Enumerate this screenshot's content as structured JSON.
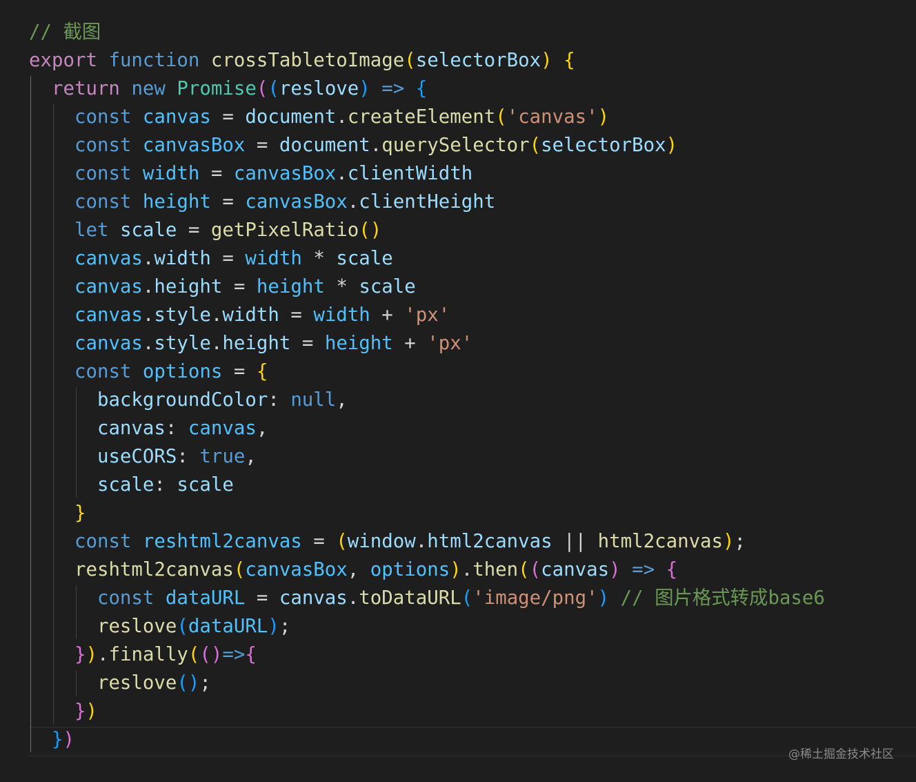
{
  "colors": {
    "background": "#1e1e1e",
    "keyword": "#c586c0",
    "storage": "#569cd6",
    "function": "#dcdcaa",
    "variable": "#9cdcfe",
    "constant": "#4fc1ff",
    "class": "#4ec9b0",
    "string": "#ce9178",
    "comment": "#6a9955",
    "text": "#d4d4d4",
    "bracket1": "#ffd700",
    "bracket2": "#da70d6",
    "bracket3": "#179fff"
  },
  "code": {
    "lines": [
      {
        "indent": 0,
        "tokens": [
          {
            "t": "// 截图",
            "c": "comment"
          }
        ]
      },
      {
        "indent": 0,
        "tokens": [
          {
            "t": "export",
            "c": "keyword"
          },
          {
            "t": " "
          },
          {
            "t": "function",
            "c": "storage"
          },
          {
            "t": " "
          },
          {
            "t": "crossTabletoImage",
            "c": "function"
          },
          {
            "t": "(",
            "c": "bracket1"
          },
          {
            "t": "selectorBox",
            "c": "variable"
          },
          {
            "t": ")",
            "c": "bracket1"
          },
          {
            "t": " "
          },
          {
            "t": "{",
            "c": "bracket1"
          }
        ]
      },
      {
        "indent": 1,
        "tokens": [
          {
            "t": "return",
            "c": "keyword"
          },
          {
            "t": " "
          },
          {
            "t": "new",
            "c": "storage"
          },
          {
            "t": " "
          },
          {
            "t": "Promise",
            "c": "class"
          },
          {
            "t": "(",
            "c": "bracket2"
          },
          {
            "t": "(",
            "c": "bracket3"
          },
          {
            "t": "reslove",
            "c": "variable"
          },
          {
            "t": ")",
            "c": "bracket3"
          },
          {
            "t": " "
          },
          {
            "t": "=>",
            "c": "storage"
          },
          {
            "t": " "
          },
          {
            "t": "{",
            "c": "bracket3"
          }
        ]
      },
      {
        "indent": 2,
        "tokens": [
          {
            "t": "const",
            "c": "storage"
          },
          {
            "t": " "
          },
          {
            "t": "canvas",
            "c": "constant"
          },
          {
            "t": " "
          },
          {
            "t": "=",
            "c": "text"
          },
          {
            "t": " "
          },
          {
            "t": "document",
            "c": "variable"
          },
          {
            "t": "."
          },
          {
            "t": "createElement",
            "c": "function"
          },
          {
            "t": "(",
            "c": "bracket1"
          },
          {
            "t": "'canvas'",
            "c": "string"
          },
          {
            "t": ")",
            "c": "bracket1"
          }
        ]
      },
      {
        "indent": 2,
        "tokens": [
          {
            "t": "const",
            "c": "storage"
          },
          {
            "t": " "
          },
          {
            "t": "canvasBox",
            "c": "constant"
          },
          {
            "t": " "
          },
          {
            "t": "=",
            "c": "text"
          },
          {
            "t": " "
          },
          {
            "t": "document",
            "c": "variable"
          },
          {
            "t": "."
          },
          {
            "t": "querySelector",
            "c": "function"
          },
          {
            "t": "(",
            "c": "bracket1"
          },
          {
            "t": "selectorBox",
            "c": "variable"
          },
          {
            "t": ")",
            "c": "bracket1"
          }
        ]
      },
      {
        "indent": 2,
        "tokens": [
          {
            "t": "const",
            "c": "storage"
          },
          {
            "t": " "
          },
          {
            "t": "width",
            "c": "constant"
          },
          {
            "t": " "
          },
          {
            "t": "=",
            "c": "text"
          },
          {
            "t": " "
          },
          {
            "t": "canvasBox",
            "c": "constant"
          },
          {
            "t": "."
          },
          {
            "t": "clientWidth",
            "c": "variable"
          }
        ]
      },
      {
        "indent": 2,
        "tokens": [
          {
            "t": "const",
            "c": "storage"
          },
          {
            "t": " "
          },
          {
            "t": "height",
            "c": "constant"
          },
          {
            "t": " "
          },
          {
            "t": "=",
            "c": "text"
          },
          {
            "t": " "
          },
          {
            "t": "canvasBox",
            "c": "constant"
          },
          {
            "t": "."
          },
          {
            "t": "clientHeight",
            "c": "variable"
          }
        ]
      },
      {
        "indent": 2,
        "tokens": [
          {
            "t": "let",
            "c": "storage"
          },
          {
            "t": " "
          },
          {
            "t": "scale",
            "c": "variable"
          },
          {
            "t": " "
          },
          {
            "t": "=",
            "c": "text"
          },
          {
            "t": " "
          },
          {
            "t": "getPixelRatio",
            "c": "function"
          },
          {
            "t": "(",
            "c": "bracket1"
          },
          {
            "t": ")",
            "c": "bracket1"
          }
        ]
      },
      {
        "indent": 2,
        "tokens": [
          {
            "t": "canvas",
            "c": "constant"
          },
          {
            "t": "."
          },
          {
            "t": "width",
            "c": "variable"
          },
          {
            "t": " "
          },
          {
            "t": "=",
            "c": "text"
          },
          {
            "t": " "
          },
          {
            "t": "width",
            "c": "constant"
          },
          {
            "t": " "
          },
          {
            "t": "*",
            "c": "text"
          },
          {
            "t": " "
          },
          {
            "t": "scale",
            "c": "variable"
          }
        ]
      },
      {
        "indent": 2,
        "tokens": [
          {
            "t": "canvas",
            "c": "constant"
          },
          {
            "t": "."
          },
          {
            "t": "height",
            "c": "variable"
          },
          {
            "t": " "
          },
          {
            "t": "=",
            "c": "text"
          },
          {
            "t": " "
          },
          {
            "t": "height",
            "c": "constant"
          },
          {
            "t": " "
          },
          {
            "t": "*",
            "c": "text"
          },
          {
            "t": " "
          },
          {
            "t": "scale",
            "c": "variable"
          }
        ]
      },
      {
        "indent": 2,
        "tokens": [
          {
            "t": "canvas",
            "c": "constant"
          },
          {
            "t": "."
          },
          {
            "t": "style",
            "c": "variable"
          },
          {
            "t": "."
          },
          {
            "t": "width",
            "c": "variable"
          },
          {
            "t": " "
          },
          {
            "t": "=",
            "c": "text"
          },
          {
            "t": " "
          },
          {
            "t": "width",
            "c": "constant"
          },
          {
            "t": " "
          },
          {
            "t": "+",
            "c": "text"
          },
          {
            "t": " "
          },
          {
            "t": "'px'",
            "c": "string"
          }
        ]
      },
      {
        "indent": 2,
        "tokens": [
          {
            "t": "canvas",
            "c": "constant"
          },
          {
            "t": "."
          },
          {
            "t": "style",
            "c": "variable"
          },
          {
            "t": "."
          },
          {
            "t": "height",
            "c": "variable"
          },
          {
            "t": " "
          },
          {
            "t": "=",
            "c": "text"
          },
          {
            "t": " "
          },
          {
            "t": "height",
            "c": "constant"
          },
          {
            "t": " "
          },
          {
            "t": "+",
            "c": "text"
          },
          {
            "t": " "
          },
          {
            "t": "'px'",
            "c": "string"
          }
        ]
      },
      {
        "indent": 2,
        "tokens": [
          {
            "t": "const",
            "c": "storage"
          },
          {
            "t": " "
          },
          {
            "t": "options",
            "c": "constant"
          },
          {
            "t": " "
          },
          {
            "t": "=",
            "c": "text"
          },
          {
            "t": " "
          },
          {
            "t": "{",
            "c": "bracket1"
          }
        ]
      },
      {
        "indent": 3,
        "tokens": [
          {
            "t": "backgroundColor",
            "c": "variable"
          },
          {
            "t": ":"
          },
          {
            "t": " "
          },
          {
            "t": "null",
            "c": "storage"
          },
          {
            "t": ","
          }
        ]
      },
      {
        "indent": 3,
        "tokens": [
          {
            "t": "canvas",
            "c": "variable"
          },
          {
            "t": ":"
          },
          {
            "t": " "
          },
          {
            "t": "canvas",
            "c": "constant"
          },
          {
            "t": ","
          }
        ]
      },
      {
        "indent": 3,
        "tokens": [
          {
            "t": "useCORS",
            "c": "variable"
          },
          {
            "t": ":"
          },
          {
            "t": " "
          },
          {
            "t": "true",
            "c": "storage"
          },
          {
            "t": ","
          }
        ]
      },
      {
        "indent": 3,
        "tokens": [
          {
            "t": "scale",
            "c": "variable"
          },
          {
            "t": ":"
          },
          {
            "t": " "
          },
          {
            "t": "scale",
            "c": "variable"
          }
        ]
      },
      {
        "indent": 2,
        "tokens": [
          {
            "t": "}",
            "c": "bracket1"
          }
        ]
      },
      {
        "indent": 2,
        "tokens": [
          {
            "t": "const",
            "c": "storage"
          },
          {
            "t": " "
          },
          {
            "t": "reshtml2canvas",
            "c": "constant"
          },
          {
            "t": " "
          },
          {
            "t": "=",
            "c": "text"
          },
          {
            "t": " "
          },
          {
            "t": "(",
            "c": "bracket1"
          },
          {
            "t": "window",
            "c": "variable"
          },
          {
            "t": "."
          },
          {
            "t": "html2canvas",
            "c": "variable"
          },
          {
            "t": " "
          },
          {
            "t": "||",
            "c": "text"
          },
          {
            "t": " "
          },
          {
            "t": "html2canvas",
            "c": "function"
          },
          {
            "t": ")",
            "c": "bracket1"
          },
          {
            "t": ";"
          }
        ]
      },
      {
        "indent": 2,
        "tokens": [
          {
            "t": "reshtml2canvas",
            "c": "function"
          },
          {
            "t": "(",
            "c": "bracket1"
          },
          {
            "t": "canvasBox",
            "c": "constant"
          },
          {
            "t": ","
          },
          {
            "t": " "
          },
          {
            "t": "options",
            "c": "constant"
          },
          {
            "t": ")",
            "c": "bracket1"
          },
          {
            "t": "."
          },
          {
            "t": "then",
            "c": "function"
          },
          {
            "t": "(",
            "c": "bracket1"
          },
          {
            "t": "(",
            "c": "bracket2"
          },
          {
            "t": "canvas",
            "c": "variable"
          },
          {
            "t": ")",
            "c": "bracket2"
          },
          {
            "t": " "
          },
          {
            "t": "=>",
            "c": "storage"
          },
          {
            "t": " "
          },
          {
            "t": "{",
            "c": "bracket2"
          }
        ]
      },
      {
        "indent": 3,
        "tokens": [
          {
            "t": "const",
            "c": "storage"
          },
          {
            "t": " "
          },
          {
            "t": "dataURL",
            "c": "constant"
          },
          {
            "t": " "
          },
          {
            "t": "=",
            "c": "text"
          },
          {
            "t": " "
          },
          {
            "t": "canvas",
            "c": "variable"
          },
          {
            "t": "."
          },
          {
            "t": "toDataURL",
            "c": "function"
          },
          {
            "t": "(",
            "c": "bracket3"
          },
          {
            "t": "'image/png'",
            "c": "string"
          },
          {
            "t": ")",
            "c": "bracket3"
          },
          {
            "t": " "
          },
          {
            "t": "// 图片格式转成base6",
            "c": "comment"
          }
        ]
      },
      {
        "indent": 3,
        "tokens": [
          {
            "t": "reslove",
            "c": "function"
          },
          {
            "t": "(",
            "c": "bracket3"
          },
          {
            "t": "dataURL",
            "c": "constant"
          },
          {
            "t": ")",
            "c": "bracket3"
          },
          {
            "t": ";"
          }
        ]
      },
      {
        "indent": 2,
        "tokens": [
          {
            "t": "}",
            "c": "bracket2"
          },
          {
            "t": ")",
            "c": "bracket1"
          },
          {
            "t": "."
          },
          {
            "t": "finally",
            "c": "function"
          },
          {
            "t": "(",
            "c": "bracket1"
          },
          {
            "t": "(",
            "c": "bracket2"
          },
          {
            "t": ")",
            "c": "bracket2"
          },
          {
            "t": "=>",
            "c": "storage"
          },
          {
            "t": "{",
            "c": "bracket2"
          }
        ]
      },
      {
        "indent": 3,
        "tokens": [
          {
            "t": "reslove",
            "c": "function"
          },
          {
            "t": "(",
            "c": "bracket3"
          },
          {
            "t": ")",
            "c": "bracket3"
          },
          {
            "t": ";"
          }
        ]
      },
      {
        "indent": 2,
        "tokens": [
          {
            "t": "}",
            "c": "bracket2"
          },
          {
            "t": ")",
            "c": "bracket1"
          }
        ]
      },
      {
        "indent": 1,
        "tokens": [
          {
            "t": "}",
            "c": "bracket3"
          },
          {
            "t": ")",
            "c": "bracket2"
          }
        ]
      }
    ]
  },
  "watermark": "@稀土掘金技术社区"
}
